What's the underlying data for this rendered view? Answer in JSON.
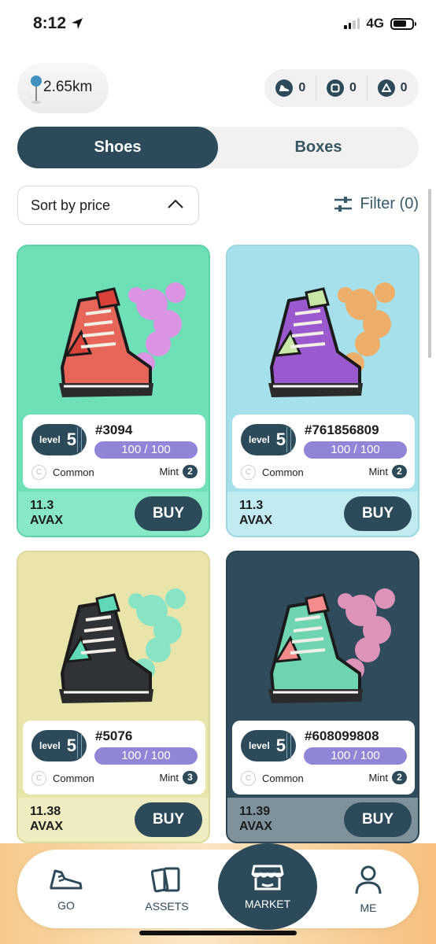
{
  "status": {
    "time": "8:12",
    "network": "4G"
  },
  "header": {
    "distance": "2.65km",
    "counters": [
      {
        "icon": "sneaker-icon",
        "value": "0"
      },
      {
        "icon": "box-icon",
        "value": "0"
      },
      {
        "icon": "avax-icon",
        "value": "0"
      }
    ]
  },
  "tabs": [
    {
      "label": "Shoes",
      "active": true
    },
    {
      "label": "Boxes",
      "active": false
    }
  ],
  "controls": {
    "sort_label": "Sort by price",
    "filter_label": "Filter (0)"
  },
  "cards": [
    {
      "id": "#3094",
      "level_word": "level",
      "level": "5",
      "durability": "100 / 100",
      "rarity": "Common",
      "mint_label": "Mint",
      "mint": "2",
      "price": "11.3",
      "currency": "AVAX",
      "buy": "BUY",
      "colors": {
        "body": "#e8655a",
        "accent": "#d84238",
        "smoke": "#e68ce8"
      }
    },
    {
      "id": "#761856809",
      "level_word": "level",
      "level": "5",
      "durability": "100 / 100",
      "rarity": "Common",
      "mint_label": "Mint",
      "mint": "2",
      "price": "11.3",
      "currency": "AVAX",
      "buy": "BUY",
      "colors": {
        "body": "#9b59d0",
        "accent": "#c9e8a8",
        "smoke": "#f4a95a"
      }
    },
    {
      "id": "#5076",
      "level_word": "level",
      "level": "5",
      "durability": "100 / 100",
      "rarity": "Common",
      "mint_label": "Mint",
      "mint": "3",
      "price": "11.38",
      "currency": "AVAX",
      "buy": "BUY",
      "colors": {
        "body": "#2f3338",
        "accent": "#5fd9b8",
        "smoke": "#7fe3c9"
      }
    },
    {
      "id": "#608099808",
      "level_word": "level",
      "level": "5",
      "durability": "100 / 100",
      "rarity": "Common",
      "mint_label": "Mint",
      "mint": "2",
      "price": "11.39",
      "currency": "AVAX",
      "buy": "BUY",
      "colors": {
        "body": "#6fd4b0",
        "accent": "#f48a8a",
        "smoke": "#f29cc4"
      }
    }
  ],
  "nav": [
    {
      "label": "GO",
      "icon": "sneaker-icon"
    },
    {
      "label": "ASSETS",
      "icon": "cards-icon"
    },
    {
      "label": "MARKET",
      "icon": "store-icon",
      "active": true
    },
    {
      "label": "ME",
      "icon": "person-icon"
    }
  ]
}
